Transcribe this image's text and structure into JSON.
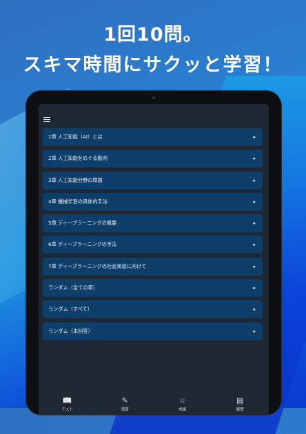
{
  "headline": {
    "line1": "1回10問。",
    "line2": "スキマ時間にサクッと学習！"
  },
  "chapters": [
    {
      "label": "1章 人工知能（AI）とは"
    },
    {
      "label": "2章 人工知能をめぐる動向"
    },
    {
      "label": "3章 人工知能分野の問題"
    },
    {
      "label": "4章 機械学習の具体的手法"
    },
    {
      "label": "5章 ディープラーニングの概要"
    },
    {
      "label": "6章 ディープラーニングの手法"
    },
    {
      "label": "7章 ディープラーニングの社会実装に向けて"
    },
    {
      "label": "ランダム（全ての章）"
    },
    {
      "label": "ランダム（すべて）"
    },
    {
      "label": "ランダム（未回答）"
    }
  ],
  "tabs": [
    {
      "label": "テスト",
      "icon": "book-icon",
      "glyph": "📖"
    },
    {
      "label": "復習",
      "icon": "pencil-icon",
      "glyph": "✎"
    },
    {
      "label": "成績",
      "icon": "star-icon",
      "glyph": "☆"
    },
    {
      "label": "履歴",
      "icon": "list-icon",
      "glyph": "▤"
    }
  ],
  "colors": {
    "item_bg": "#0e3f6a",
    "screen_bg": "#1f2733"
  }
}
